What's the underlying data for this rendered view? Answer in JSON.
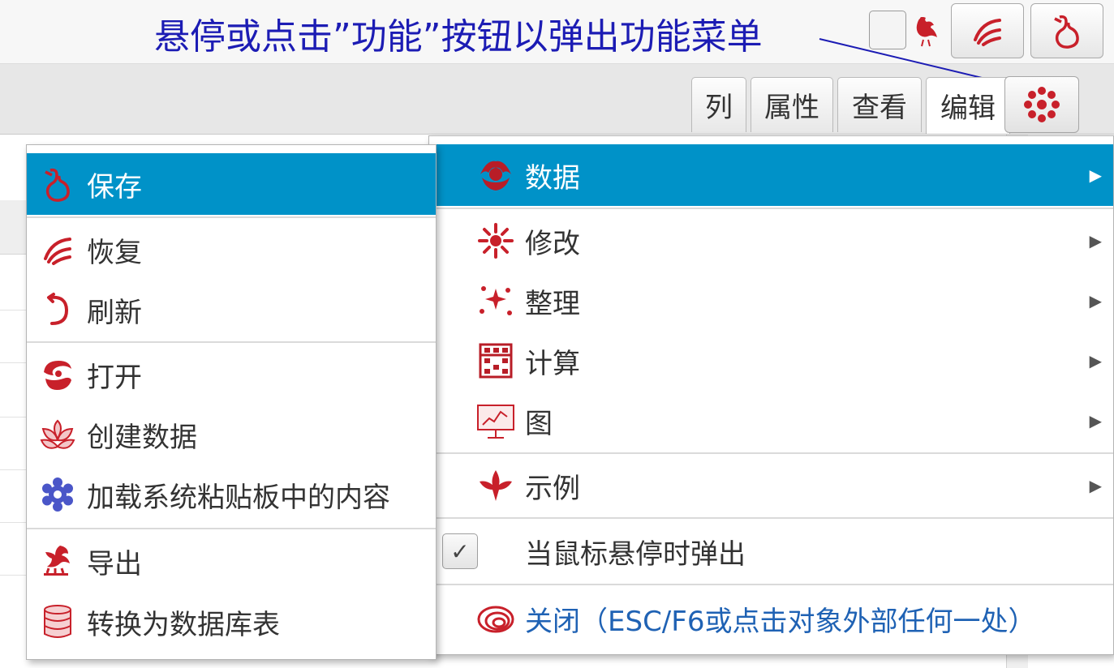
{
  "hint": {
    "text": "悬停或点击”功能”按钮以弹出功能菜单"
  },
  "tabs": [
    {
      "label": "列"
    },
    {
      "label": "属性"
    },
    {
      "label": "查看"
    },
    {
      "label": "编辑"
    }
  ],
  "icons": {
    "top_small": "rooster-icon",
    "top_button_1": "swirl-icon",
    "top_button_2": "gourd-icon",
    "function_tab": "flower-icon"
  },
  "menu_left": {
    "items": [
      {
        "label": "保存",
        "icon": "gourd-icon"
      },
      {
        "label": "恢复",
        "icon": "swirl-icon"
      },
      {
        "label": "刷新",
        "icon": "refresh-icon"
      },
      {
        "label": "打开",
        "icon": "open-swirl-icon"
      },
      {
        "label": "创建数据",
        "icon": "lotus-icon"
      },
      {
        "label": "加载系统粘贴板中的内容",
        "icon": "gear-icon"
      },
      {
        "label": "导出",
        "icon": "dragon-icon"
      },
      {
        "label": "转换为数据库表",
        "icon": "database-icon"
      }
    ]
  },
  "menu_right": {
    "items": [
      {
        "label": "数据",
        "icon": "peony-icon"
      },
      {
        "label": "修改",
        "icon": "chrysanthemum-icon"
      },
      {
        "label": "整理",
        "icon": "sparkle-icon"
      },
      {
        "label": "计算",
        "icon": "abacus-icon"
      },
      {
        "label": "图",
        "icon": "chart-board-icon"
      },
      {
        "label": "示例",
        "icon": "leaf-icon"
      }
    ],
    "popup_on_hover": {
      "label": "当鼠标悬停时弹出",
      "checked": true,
      "check_glyph": "✓"
    },
    "close": {
      "label": "关闭（ESC/F6或点击对象外部任何一处）",
      "icon": "spiral-icon"
    }
  },
  "colors": {
    "highlight": "#0092c8",
    "icon_red": "#c8202a",
    "hint_blue": "#1c1cb4",
    "close_blue": "#1f62b4"
  }
}
